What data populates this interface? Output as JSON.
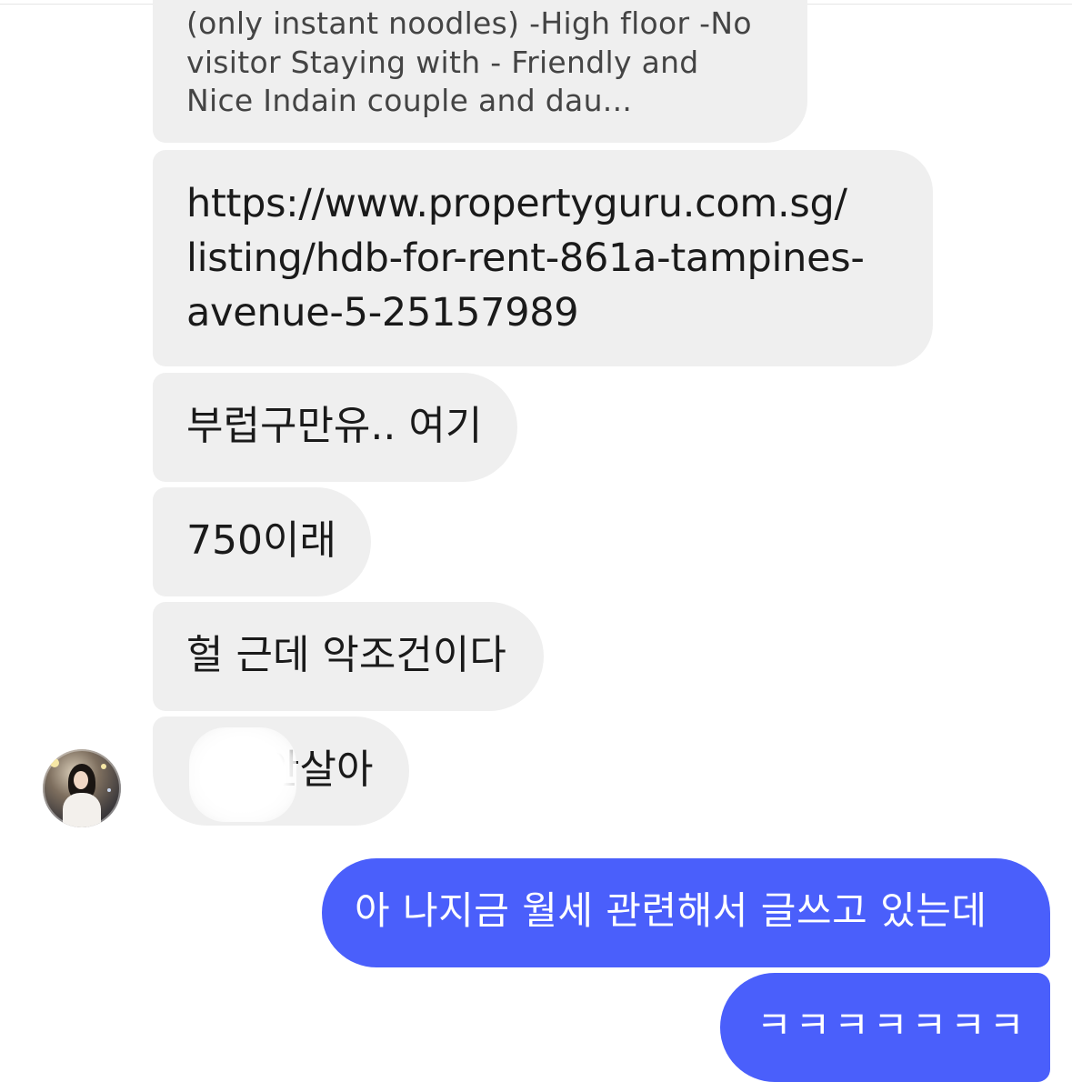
{
  "conversation": {
    "received": [
      {
        "name": "listing-preview",
        "text": "(only instant noodles) -High floor -No\nvisitor Staying with - Friendly and\nNice Indain couple and dau..."
      },
      {
        "name": "listing-link",
        "text": "https://www.propertyguru.com.sg/\nlisting/hdb-for-rent-861a-tampines-\navenue-5-25157989"
      },
      {
        "name": "message-3",
        "text": "부럽구만유.. 여기"
      },
      {
        "name": "message-4",
        "text": "750이래"
      },
      {
        "name": "message-5",
        "text": "헐 근데 악조건이다"
      },
      {
        "name": "message-6",
        "text": "안살아"
      }
    ],
    "sent": [
      {
        "name": "sent-1",
        "text": "아 나지금 월세 관련해서 글쓰고 있는데"
      },
      {
        "name": "sent-2",
        "text": "ㅋㅋㅋㅋㅋㅋㅋ"
      }
    ]
  },
  "colors": {
    "received_bubble": "#efefef",
    "sent_bubble": "#4a5ffb",
    "received_text": "#1a1a1a",
    "sent_text": "#ffffff"
  },
  "icons": {
    "avatar": "contact-avatar-photo"
  }
}
